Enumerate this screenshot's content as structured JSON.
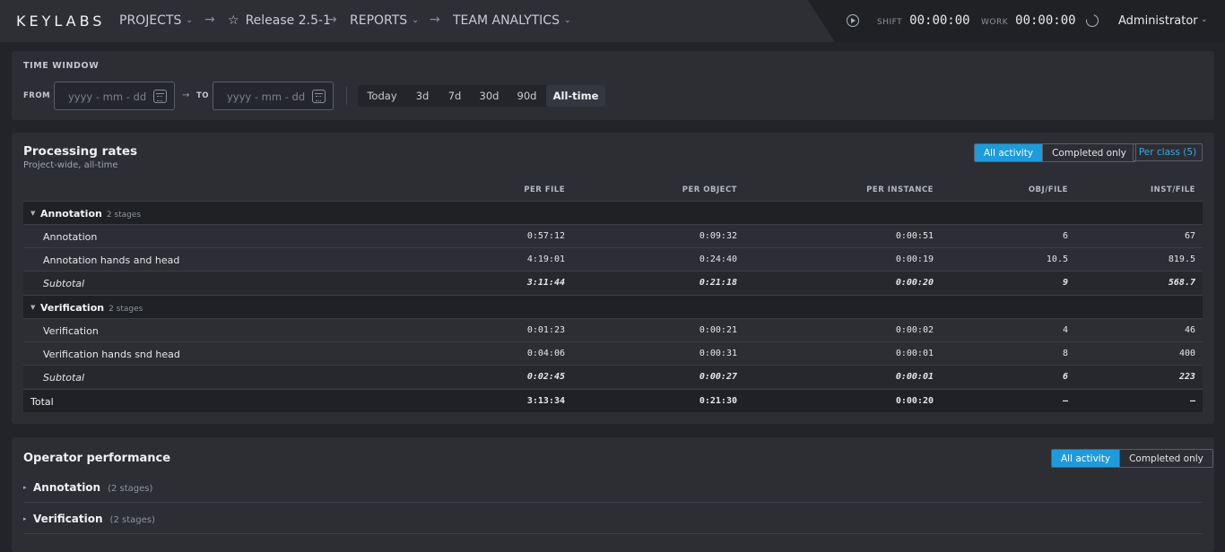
{
  "header": {
    "logo": "KEYLABS",
    "nav": [
      {
        "label": "PROJECTS"
      },
      {
        "label": "Release 2.5-1"
      },
      {
        "label": "REPORTS"
      },
      {
        "label": "TEAM ANALYTICS"
      }
    ],
    "shift_label": "SHIFT",
    "shift_time": "00:00:00",
    "work_label": "WORK",
    "work_time": "00:00:00",
    "user": "Administrator"
  },
  "time_window": {
    "title": "TIME WINDOW",
    "from_label": "FROM",
    "to_label": "TO",
    "from_placeholder": "yyyy - mm - dd",
    "to_placeholder": "yyyy - mm - dd",
    "ranges": [
      "Today",
      "3d",
      "7d",
      "30d",
      "90d",
      "All-time"
    ],
    "active_range": "All-time"
  },
  "processing_rates": {
    "title": "Processing rates",
    "subtitle": "Project-wide, all-time",
    "toggle": [
      "All activity",
      "Completed only"
    ],
    "active_toggle": "All activity",
    "per_class": "Per class (5)",
    "columns": [
      "PER FILE",
      "PER OBJECT",
      "PER INSTANCE",
      "OBJ/FILE",
      "INST/FILE"
    ],
    "groups": [
      {
        "name": "Annotation",
        "stages": "2 stages",
        "rows": [
          {
            "name": "Annotation",
            "per_file": "0:57:12",
            "per_object": "0:09:32",
            "per_instance": "0:00:51",
            "obj_file": "6",
            "inst_file": "67"
          },
          {
            "name": "Annotation hands and head",
            "per_file": "4:19:01",
            "per_object": "0:24:40",
            "per_instance": "0:00:19",
            "obj_file": "10.5",
            "inst_file": "819.5"
          }
        ],
        "subtotal": {
          "name": "Subtotal",
          "per_file": "3:11:44",
          "per_object": "0:21:18",
          "per_instance": "0:00:20",
          "obj_file": "9",
          "inst_file": "568.7"
        }
      },
      {
        "name": "Verification",
        "stages": "2 stages",
        "rows": [
          {
            "name": "Verification",
            "per_file": "0:01:23",
            "per_object": "0:00:21",
            "per_instance": "0:00:02",
            "obj_file": "4",
            "inst_file": "46"
          },
          {
            "name": "Verification hands snd head",
            "per_file": "0:04:06",
            "per_object": "0:00:31",
            "per_instance": "0:00:01",
            "obj_file": "8",
            "inst_file": "400"
          }
        ],
        "subtotal": {
          "name": "Subtotal",
          "per_file": "0:02:45",
          "per_object": "0:00:27",
          "per_instance": "0:00:01",
          "obj_file": "6",
          "inst_file": "223"
        }
      }
    ],
    "total": {
      "name": "Total",
      "per_file": "3:13:34",
      "per_object": "0:21:30",
      "per_instance": "0:00:20",
      "obj_file": "–",
      "inst_file": "–"
    }
  },
  "operator_performance": {
    "title": "Operator performance",
    "toggle": [
      "All activity",
      "Completed only"
    ],
    "active_toggle": "All activity",
    "groups": [
      {
        "name": "Annotation",
        "stages": "(2 stages)"
      },
      {
        "name": "Verification",
        "stages": "(2 stages)"
      }
    ]
  },
  "colors": {
    "accent": "#1d9bdc",
    "background": "#222429",
    "panel": "#2c2e34"
  }
}
